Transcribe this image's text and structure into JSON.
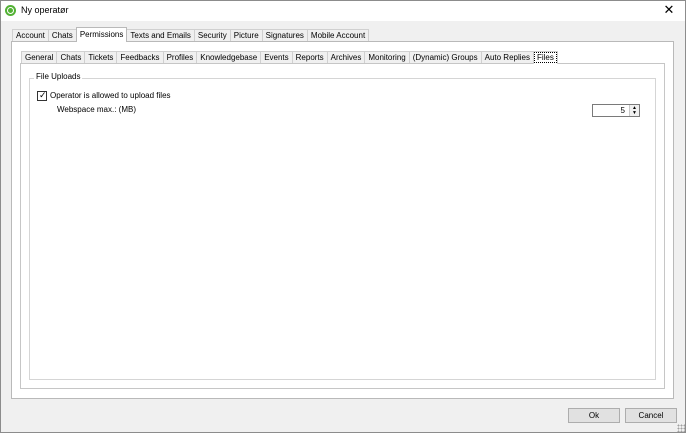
{
  "window": {
    "title": "Ny operatør",
    "close_symbol": "✕"
  },
  "outer_tabs": [
    "Account",
    "Chats",
    "Permissions",
    "Texts and Emails",
    "Security",
    "Picture",
    "Signatures",
    "Mobile Account"
  ],
  "outer_active": "Permissions",
  "inner_tabs": [
    "General",
    "Chats",
    "Tickets",
    "Feedbacks",
    "Profiles",
    "Knowledgebase",
    "Events",
    "Reports",
    "Archives",
    "Monitoring",
    "(Dynamic) Groups",
    "Auto Replies",
    "Files"
  ],
  "inner_active": "Files",
  "file_uploads": {
    "group_label": "File Uploads",
    "allow_upload_label": "Operator is allowed to upload files",
    "allow_upload_checked": true,
    "webspace_label": "Webspace max.: (MB)",
    "webspace_value": "5"
  },
  "buttons": {
    "ok": "Ok",
    "cancel": "Cancel"
  }
}
